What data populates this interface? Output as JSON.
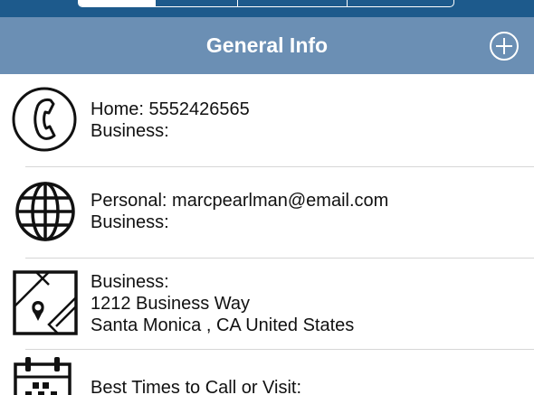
{
  "segments": [
    {
      "label": "",
      "selected": true
    },
    {
      "label": "",
      "selected": false
    },
    {
      "label": "",
      "selected": false
    },
    {
      "label": "",
      "selected": false
    }
  ],
  "navbar": {
    "title": "General Info",
    "add_icon": "plus-circle-icon"
  },
  "rows": {
    "phone": {
      "icon": "phone-icon",
      "home": "Home: 5552426565",
      "business": "Business:"
    },
    "email": {
      "icon": "globe-icon",
      "personal": "Personal: marcpearlman@email.com",
      "business": "Business:"
    },
    "address": {
      "icon": "map-icon",
      "label": "Business:",
      "street": "1212 Business Way",
      "city": "Santa Monica , CA United States"
    },
    "best_times": {
      "icon": "calendar-icon",
      "label": "Best Times to Call or Visit:"
    }
  },
  "colors": {
    "top_strip": "#1d5a8c",
    "navbar": "#6b8fb4",
    "separator": "#d6d6d6"
  }
}
